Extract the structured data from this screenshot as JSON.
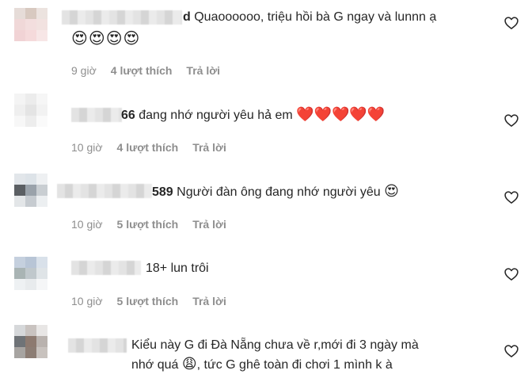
{
  "comments": [
    {
      "name_tail": "d",
      "text": "Quaoooooo, triệu hồi bà G ngay và lunnn ạ",
      "emojis": "😍😍😍😍",
      "time": "9 giờ",
      "likes": "4 lượt thích",
      "reply": "Trả lời"
    },
    {
      "name_tail": "66",
      "text": "đang nhớ người yêu hả em",
      "emojis": "❤️❤️❤️❤️❤️",
      "time": "10 giờ",
      "likes": "4 lượt thích",
      "reply": "Trả lời"
    },
    {
      "name_tail": "589",
      "text": "Người đàn ông đang nhớ người yêu",
      "emojis": "😍",
      "time": "10 giờ",
      "likes": "5 lượt thích",
      "reply": "Trả lời"
    },
    {
      "name_tail": "",
      "text": "18+ lun trôi",
      "emojis": "",
      "time": "10 giờ",
      "likes": "5 lượt thích",
      "reply": "Trả lời"
    },
    {
      "name_tail": "",
      "text": "Kiểu này G đi Đà Nẵng chưa về r,mới đi 3 ngày mà",
      "text2": "nhớ quá",
      "emoji2": "😩",
      "text3": ", tức G ghê toàn đi chơi 1 mình k à"
    }
  ],
  "icons": {
    "like": "heart-outline-icon"
  }
}
